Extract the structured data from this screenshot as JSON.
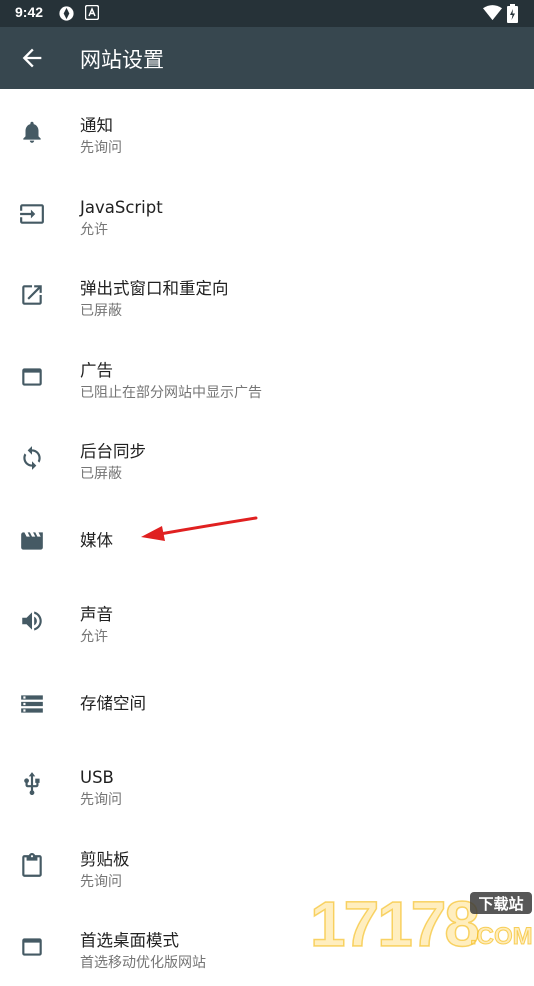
{
  "status_bar": {
    "time": "9:42"
  },
  "app_bar": {
    "title": "网站设置"
  },
  "items": [
    {
      "title": "通知",
      "subtitle": "先询问"
    },
    {
      "title": "JavaScript",
      "subtitle": "允许"
    },
    {
      "title": "弹出式窗口和重定向",
      "subtitle": "已屏蔽"
    },
    {
      "title": "广告",
      "subtitle": "已阻止在部分网站中显示广告"
    },
    {
      "title": "后台同步",
      "subtitle": "已屏蔽"
    },
    {
      "title": "媒体"
    },
    {
      "title": "声音",
      "subtitle": "允许"
    },
    {
      "title": "存储空间"
    },
    {
      "title": "USB",
      "subtitle": "先询问"
    },
    {
      "title": "剪贴板",
      "subtitle": "先询问"
    },
    {
      "title": "首选桌面模式",
      "subtitle": "首选移动优化版网站"
    }
  ],
  "watermark": {
    "number": "17178",
    "badge": "下载站",
    "suffix": ".COM"
  },
  "colors": {
    "status_bar": "#263238",
    "app_bar": "#37474f",
    "icon": "#455a64",
    "annotation_arrow": "#e02020"
  }
}
